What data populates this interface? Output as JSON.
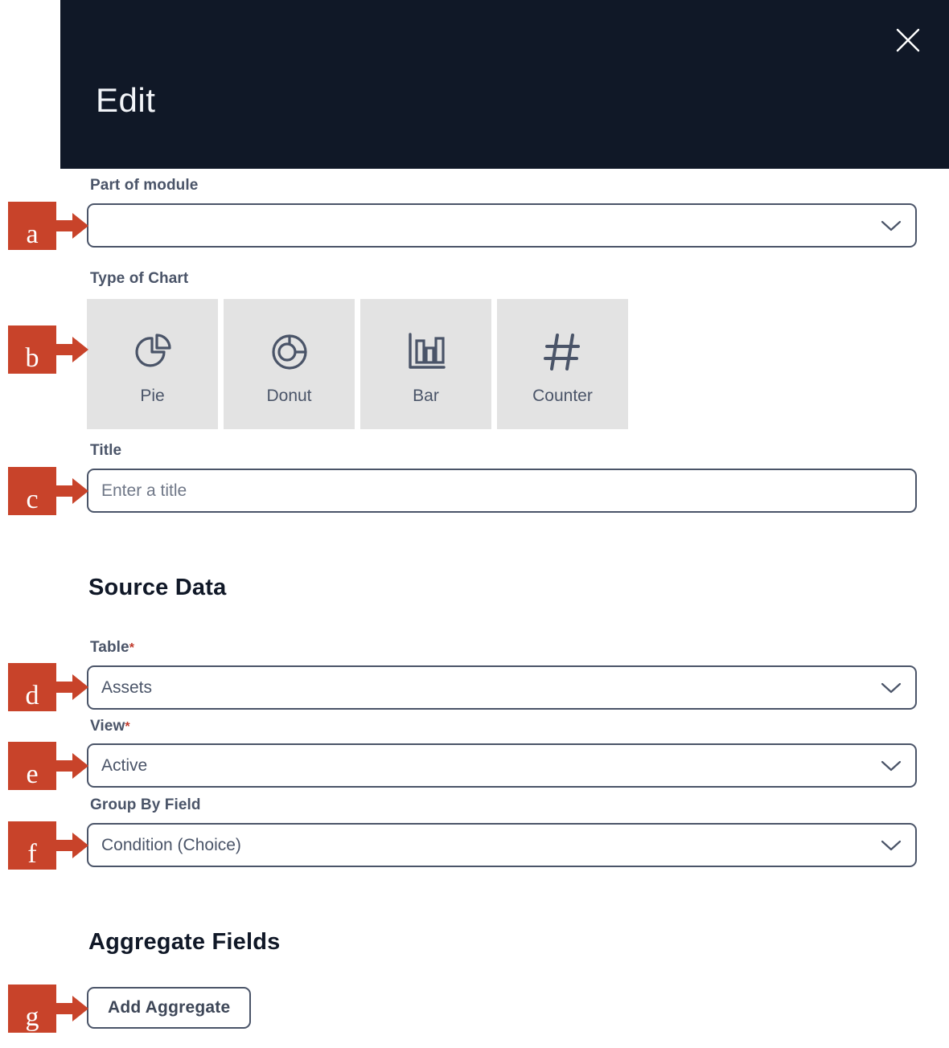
{
  "modal": {
    "title": "Edit",
    "close_icon": "close-icon"
  },
  "form": {
    "part_of_module": {
      "label": "Part of module",
      "value": "",
      "placeholder": "",
      "chevron_icon": "chevron-down-icon"
    },
    "type_of_chart": {
      "label": "Type of Chart",
      "options": [
        {
          "label": "Pie",
          "icon": "pie-chart-icon"
        },
        {
          "label": "Donut",
          "icon": "donut-chart-icon"
        },
        {
          "label": "Bar",
          "icon": "bar-chart-icon"
        },
        {
          "label": "Counter",
          "icon": "hash-counter-icon"
        }
      ]
    },
    "title_field": {
      "label": "Title",
      "value": "",
      "placeholder": "Enter a title"
    }
  },
  "source_data": {
    "heading": "Source Data",
    "table": {
      "label": "Table",
      "required_marker": "*",
      "value": "Assets",
      "chevron_icon": "chevron-down-icon"
    },
    "view": {
      "label": "View",
      "required_marker": "*",
      "value": "Active",
      "chevron_icon": "chevron-down-icon"
    },
    "group_by_field": {
      "label": "Group By Field",
      "value": "Condition (Choice)",
      "chevron_icon": "chevron-down-icon"
    }
  },
  "aggregate_fields": {
    "heading": "Aggregate Fields",
    "add_button_label": "Add Aggregate"
  },
  "annotations": [
    {
      "letter": "a",
      "target": "part-of-module-select"
    },
    {
      "letter": "b",
      "target": "type-of-chart-cards"
    },
    {
      "letter": "c",
      "target": "title-input"
    },
    {
      "letter": "d",
      "target": "table-select"
    },
    {
      "letter": "e",
      "target": "view-select"
    },
    {
      "letter": "f",
      "target": "group-by-field-select"
    },
    {
      "letter": "g",
      "target": "add-aggregate-button"
    }
  ],
  "colors": {
    "header_bg": "#101827",
    "annotation": "#c8432a",
    "label_text": "#4a5468",
    "card_bg": "#e3e3e3",
    "required_star": "#c0392b"
  }
}
